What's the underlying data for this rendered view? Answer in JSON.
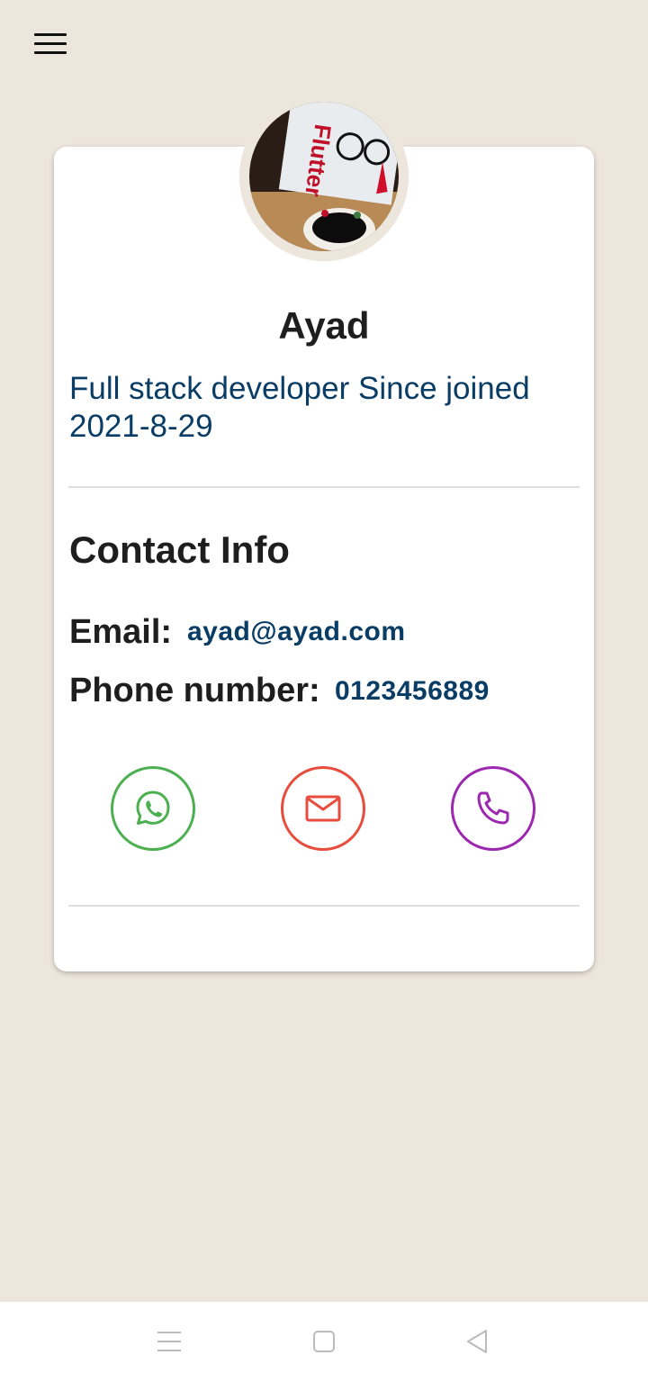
{
  "header": {
    "menu_icon": "hamburger-menu-icon"
  },
  "profile": {
    "name": "Ayad",
    "bio": "Full stack developer Since joined 2021-8-29",
    "avatar_text": "Flutter"
  },
  "contact": {
    "title": "Contact Info",
    "email_label": "Email:",
    "email_value": "ayad@ayad.com",
    "phone_label": "Phone number:",
    "phone_value": "0123456889"
  },
  "actions": [
    {
      "name": "whatsapp",
      "icon": "whatsapp-icon",
      "color": "#4caf50"
    },
    {
      "name": "email",
      "icon": "mail-icon",
      "color": "#e74c3c"
    },
    {
      "name": "phone",
      "icon": "phone-icon",
      "color": "#9c27b0"
    }
  ],
  "colors": {
    "background": "#ede6dc",
    "accent_text": "#0a3d66"
  },
  "system_nav": {
    "recents_icon": "recents-icon",
    "home_icon": "home-icon",
    "back_icon": "back-icon"
  }
}
